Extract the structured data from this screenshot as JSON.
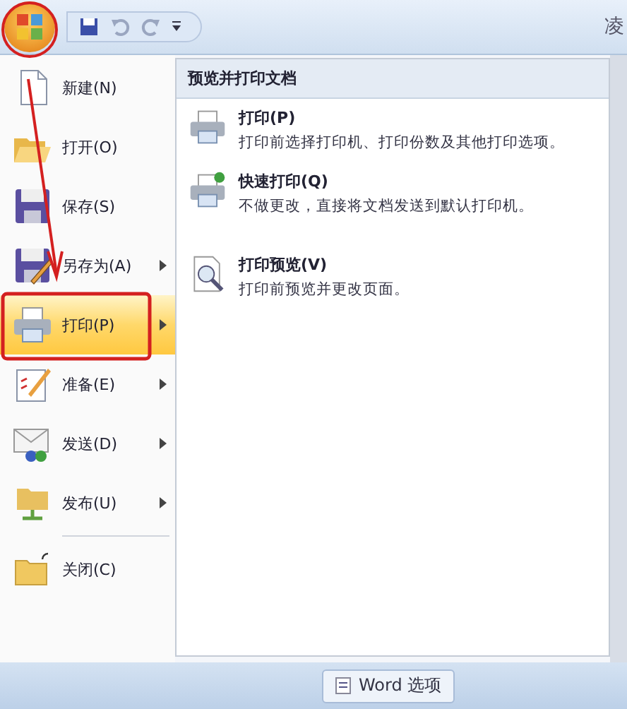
{
  "window": {
    "title": "凌"
  },
  "menu": {
    "items": [
      {
        "label": "新建(N)",
        "kind": "new",
        "submenu": false,
        "selected": false,
        "separator_before": false
      },
      {
        "label": "打开(O)",
        "kind": "open",
        "submenu": false,
        "selected": false,
        "separator_before": false
      },
      {
        "label": "保存(S)",
        "kind": "save",
        "submenu": false,
        "selected": false,
        "separator_before": false
      },
      {
        "label": "另存为(A)",
        "kind": "saveas",
        "submenu": true,
        "selected": false,
        "separator_before": false
      },
      {
        "label": "打印(P)",
        "kind": "print",
        "submenu": true,
        "selected": true,
        "separator_before": false
      },
      {
        "label": "准备(E)",
        "kind": "prepare",
        "submenu": true,
        "selected": false,
        "separator_before": false
      },
      {
        "label": "发送(D)",
        "kind": "send",
        "submenu": true,
        "selected": false,
        "separator_before": false
      },
      {
        "label": "发布(U)",
        "kind": "publish",
        "submenu": true,
        "selected": false,
        "separator_before": false
      },
      {
        "label": "关闭(C)",
        "kind": "close",
        "submenu": false,
        "selected": false,
        "separator_before": true
      }
    ]
  },
  "submenu": {
    "header": "预览并打印文档",
    "items": [
      {
        "title": "打印(P)",
        "description": "打印前选择打印机、打印份数及其他打印选项。",
        "kind": "print"
      },
      {
        "title": "快速打印(Q)",
        "description": "不做更改，直接将文档发送到默认打印机。",
        "kind": "quickprint"
      },
      {
        "title": "打印预览(V)",
        "description": "打印前预览并更改页面。",
        "kind": "preview"
      }
    ]
  },
  "footer": {
    "options_button": "Word 选项"
  }
}
